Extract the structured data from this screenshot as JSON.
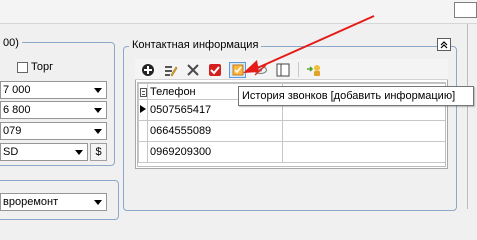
{
  "left_panel": {
    "group_caption": "00)",
    "torg_checkbox_label": "Торг",
    "combo_values": [
      "7 000",
      "6 800",
      "079"
    ],
    "currency_value": "SD",
    "currency_button_label": "$",
    "lower_combo_value": "вроремонт"
  },
  "contact_info": {
    "caption": "Контактная информация",
    "toolbar_icons": [
      "add-icon",
      "edit-icon",
      "delete-icon",
      "checkmark-icon",
      "call-history-icon",
      "hide-icon",
      "columns-icon",
      "export-icon"
    ],
    "table": {
      "column_header": "Телефон",
      "rows": [
        "0507565417",
        "0664555089",
        "0969209300"
      ]
    },
    "tooltip": "История звонков [добавить информацию]"
  },
  "colors": {
    "group_border": "#8da8c8",
    "tooltip_border": "#767676",
    "arrow": "#e41b17",
    "selected_border": "#5b99d8"
  }
}
